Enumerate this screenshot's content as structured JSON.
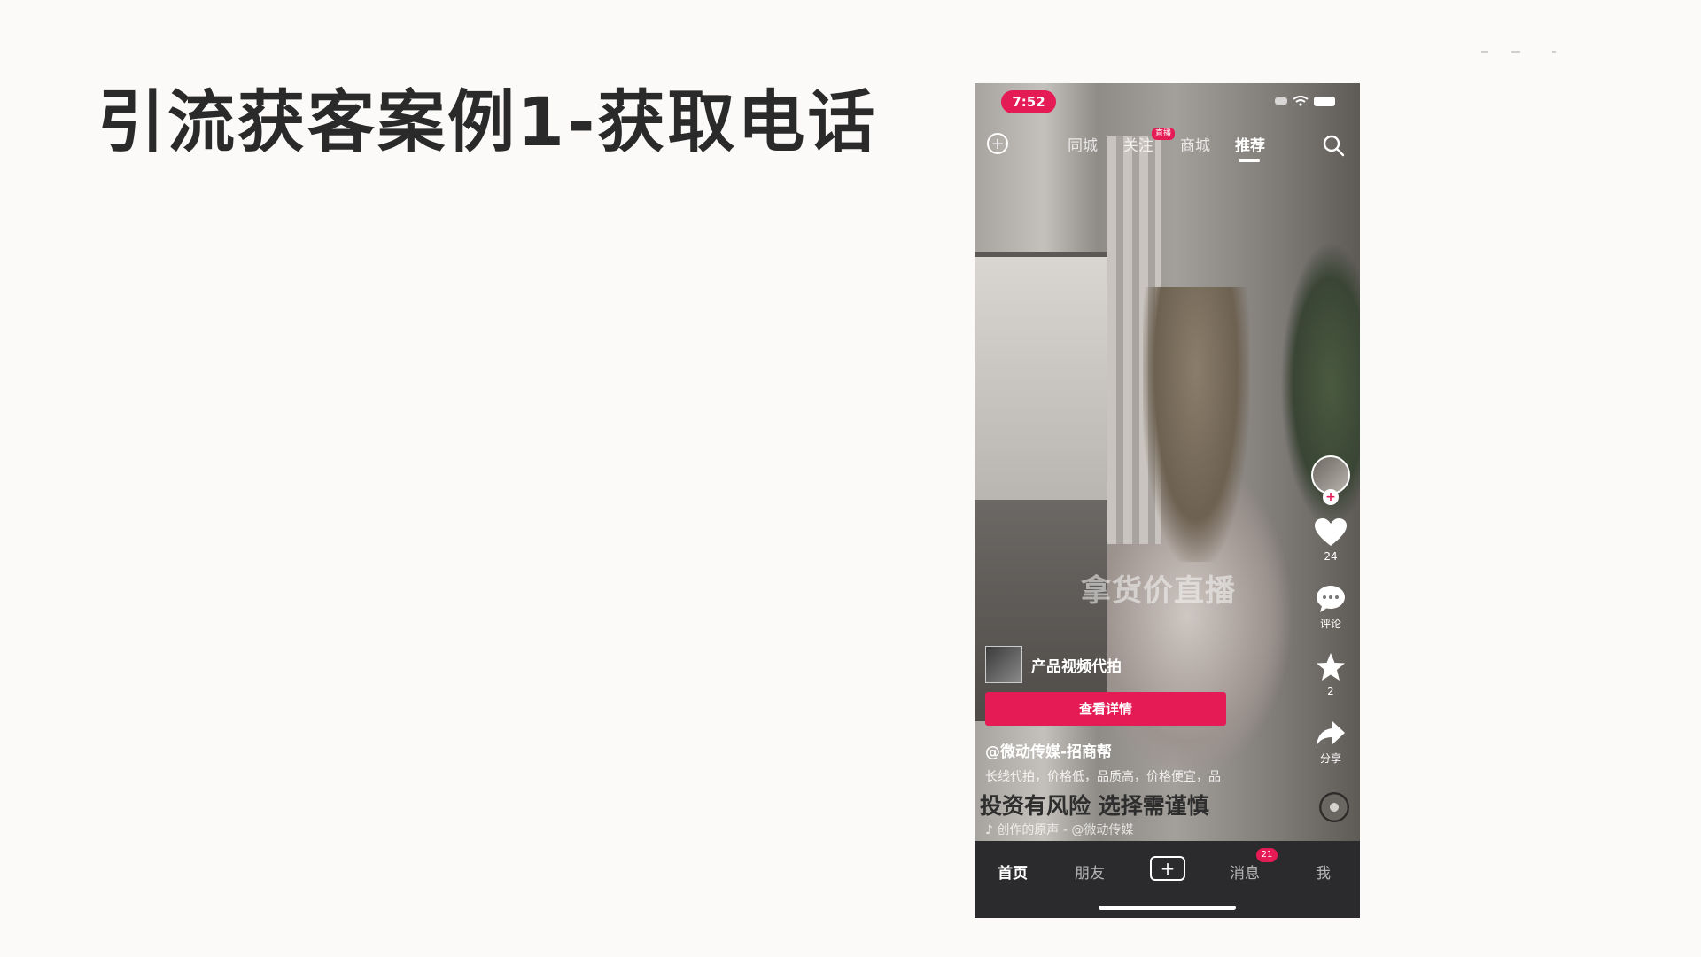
{
  "slide": {
    "title": "引流获客案例1-获取电话"
  },
  "phone": {
    "status": {
      "time": "7:52"
    },
    "top_tabs": [
      {
        "label": "同城",
        "active": false
      },
      {
        "label": "关注",
        "active": false,
        "badge": "直播"
      },
      {
        "label": "商城",
        "active": false
      },
      {
        "label": "推荐",
        "active": true
      }
    ],
    "icons": {
      "top_left": "plus-circle-icon",
      "top_right": "search-icon"
    },
    "video": {
      "caption_overlay": "拿货价直播",
      "product_name": "产品视频代拍",
      "detail_button": "查看详情",
      "author": "@微动传媒-招商帮",
      "description": "长线代拍，价格低，品质高，价格便宜，品",
      "risk_warning": "投资有风险 选择需谨慎",
      "music": "♪ 创作的原声 - @微动传媒"
    },
    "sidebar": {
      "likes_count": "24",
      "comment_label": "评论",
      "favorites_count": "2",
      "share_label": "分享"
    },
    "bottom_nav": [
      {
        "label": "首页",
        "active": true
      },
      {
        "label": "朋友",
        "active": false
      },
      {
        "label": "消息",
        "active": false,
        "badge": "21"
      },
      {
        "label": "我",
        "active": false
      }
    ],
    "colors": {
      "accent": "#e51b55",
      "nav_bg": "#2b2a2c"
    }
  }
}
